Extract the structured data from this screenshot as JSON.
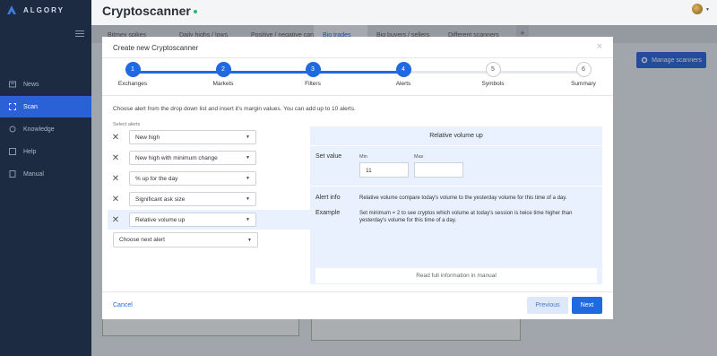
{
  "app": {
    "logo_text": "ALGORY",
    "title": "Cryptoscanner",
    "manage_scanners": "Manage scanners",
    "status_color": "#2bb673",
    "accent_color": "#1f6ae0"
  },
  "sidebar": {
    "items": [
      {
        "label": "News",
        "icon": "news-icon"
      },
      {
        "label": "Scan",
        "icon": "scan-icon",
        "active": true
      },
      {
        "label": "Knowledge",
        "icon": "knowledge-icon"
      },
      {
        "label": "Help",
        "icon": "help-icon"
      },
      {
        "label": "Manual",
        "icon": "manual-icon"
      }
    ]
  },
  "background_tabs": [
    {
      "label": "Bitmex spikes"
    },
    {
      "label": "Daily highs / lows"
    },
    {
      "label": "Positive / negative candles"
    },
    {
      "label": "Big trades",
      "active": true
    },
    {
      "label": "Big buyers / sellers"
    },
    {
      "label": "Different scanners"
    },
    {
      "label": "+"
    }
  ],
  "modal": {
    "title": "Create new Cryptoscanner",
    "close_glyph": "×",
    "steps": [
      {
        "number": "1",
        "label": "Exchanges",
        "done": true
      },
      {
        "number": "2",
        "label": "Markets",
        "done": true
      },
      {
        "number": "3",
        "label": "Filters",
        "done": true
      },
      {
        "number": "4",
        "label": "Alerts",
        "done": true
      },
      {
        "number": "5",
        "label": "Symbols",
        "done": false
      },
      {
        "number": "6",
        "label": "Summary",
        "done": false
      }
    ],
    "instruction": "Choose alert from the drop down list and insert it's margin values. You can add up to 10 alerts.",
    "select_alerts_label": "Select alerts",
    "alerts": [
      {
        "label": "New high"
      },
      {
        "label": "New high with minimum change"
      },
      {
        "label": "% up for the day"
      },
      {
        "label": "Significant ask size"
      },
      {
        "label": "Relative volume up",
        "selected": true
      }
    ],
    "next_alert_placeholder": "Choose next alert",
    "detail": {
      "title": "Relative volume up",
      "set_value_label": "Set value",
      "min_label": "Min",
      "max_label": "Max",
      "min_value": "11",
      "max_value": "",
      "alert_info_label": "Alert info",
      "alert_info_text": "Relative volume compare today's volume to the yesterday volume for this time of a day.",
      "example_label": "Example",
      "example_text": "Set minimum = 2 to see cryptos which volume at today's session is twice time higher than yesterday's volume for this time of a day.",
      "manual_button": "Read full information in manual"
    },
    "cancel_label": "Cancel",
    "previous_label": "Previous",
    "next_label": "Next"
  }
}
